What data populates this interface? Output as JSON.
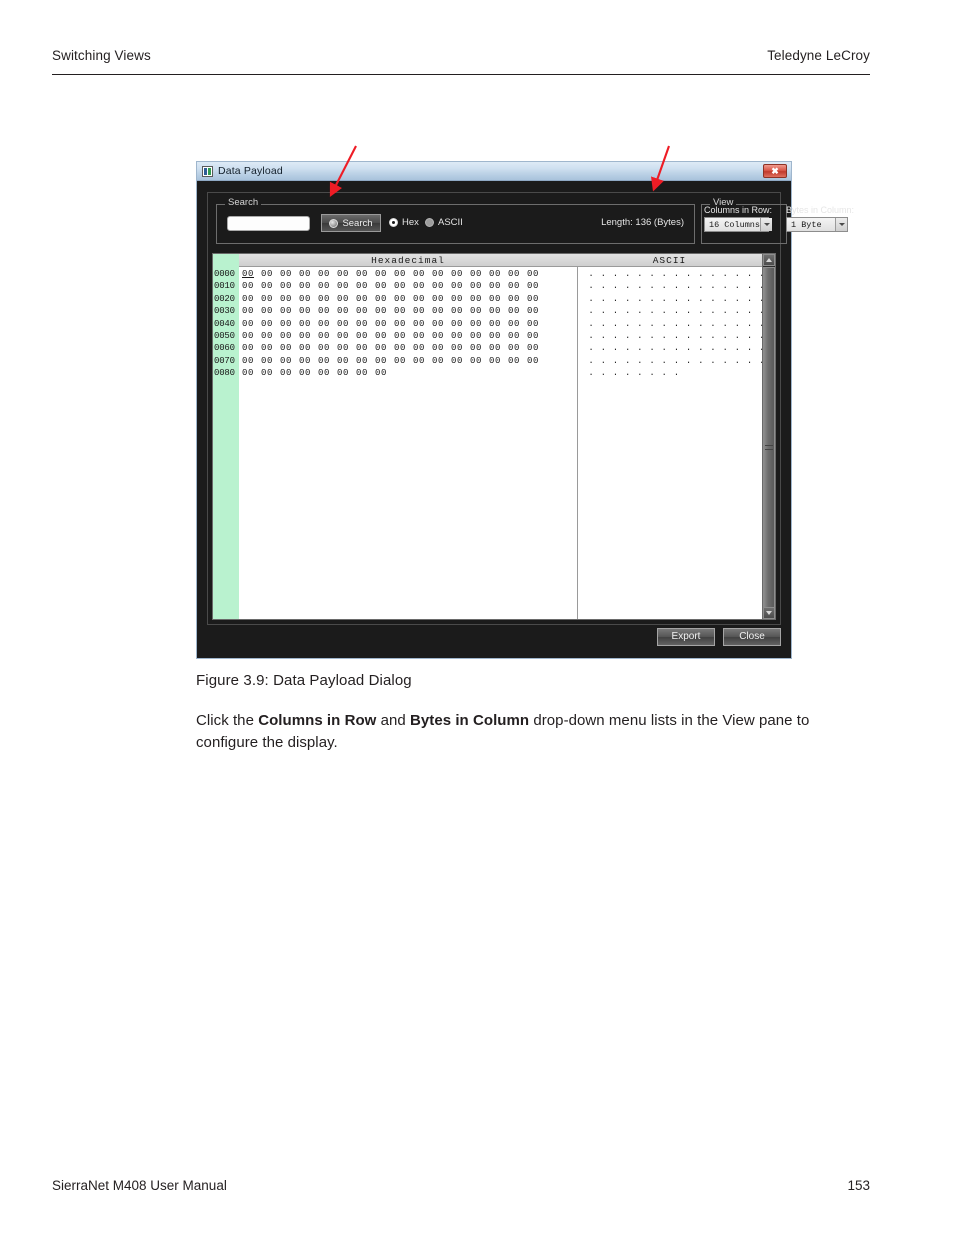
{
  "page": {
    "header_left": "Switching Views",
    "header_right": "Teledyne LeCroy",
    "footer_left": "SierraNet M408 User Manual",
    "footer_right": "153"
  },
  "figure": {
    "caption": "Figure 3.9:  Data Payload Dialog"
  },
  "body": {
    "line_part1": "Click the ",
    "bold1": "Columns in Row",
    "line_part2": " and ",
    "bold2": "Bytes in Column",
    "line_part3": " drop-down menu lists in the View pane to configure the display."
  },
  "dialog": {
    "title": "Data Payload",
    "close_label": "✖",
    "search": {
      "group_label": "Search",
      "input_value": "",
      "input_placeholder": "",
      "button_label": "Search",
      "radio_hex_label": "Hex",
      "radio_ascii_label": "ASCII",
      "radio_selected": "Hex",
      "length_label": "Length: 136 (Bytes)"
    },
    "view": {
      "group_label": "View",
      "columns_in_row_label": "Columns in Row:",
      "bytes_in_column_label": "Bytes in Column:",
      "columns_in_row_value": "16  Columns",
      "bytes_in_column_value": "1 Byte"
    },
    "hexview": {
      "header_hex": "Hexadecimal",
      "header_ascii": "ASCII",
      "rows": [
        {
          "offset": "0000",
          "bytes": [
            "00",
            "00",
            "00",
            "00",
            "00",
            "00",
            "00",
            "00",
            "00",
            "00",
            "00",
            "00",
            "00",
            "00",
            "00",
            "00"
          ],
          "ascii": [
            ".",
            ".",
            ".",
            ".",
            ".",
            ".",
            ".",
            ".",
            ".",
            ".",
            ".",
            ".",
            ".",
            ".",
            ".",
            "."
          ]
        },
        {
          "offset": "0010",
          "bytes": [
            "00",
            "00",
            "00",
            "00",
            "00",
            "00",
            "00",
            "00",
            "00",
            "00",
            "00",
            "00",
            "00",
            "00",
            "00",
            "00"
          ],
          "ascii": [
            ".",
            ".",
            ".",
            ".",
            ".",
            ".",
            ".",
            ".",
            ".",
            ".",
            ".",
            ".",
            ".",
            ".",
            ".",
            "."
          ]
        },
        {
          "offset": "0020",
          "bytes": [
            "00",
            "00",
            "00",
            "00",
            "00",
            "00",
            "00",
            "00",
            "00",
            "00",
            "00",
            "00",
            "00",
            "00",
            "00",
            "00"
          ],
          "ascii": [
            ".",
            ".",
            ".",
            ".",
            ".",
            ".",
            ".",
            ".",
            ".",
            ".",
            ".",
            ".",
            ".",
            ".",
            ".",
            "."
          ]
        },
        {
          "offset": "0030",
          "bytes": [
            "00",
            "00",
            "00",
            "00",
            "00",
            "00",
            "00",
            "00",
            "00",
            "00",
            "00",
            "00",
            "00",
            "00",
            "00",
            "00"
          ],
          "ascii": [
            ".",
            ".",
            ".",
            ".",
            ".",
            ".",
            ".",
            ".",
            ".",
            ".",
            ".",
            ".",
            ".",
            ".",
            ".",
            "."
          ]
        },
        {
          "offset": "0040",
          "bytes": [
            "00",
            "00",
            "00",
            "00",
            "00",
            "00",
            "00",
            "00",
            "00",
            "00",
            "00",
            "00",
            "00",
            "00",
            "00",
            "00"
          ],
          "ascii": [
            ".",
            ".",
            ".",
            ".",
            ".",
            ".",
            ".",
            ".",
            ".",
            ".",
            ".",
            ".",
            ".",
            ".",
            ".",
            "."
          ]
        },
        {
          "offset": "0050",
          "bytes": [
            "00",
            "00",
            "00",
            "00",
            "00",
            "00",
            "00",
            "00",
            "00",
            "00",
            "00",
            "00",
            "00",
            "00",
            "00",
            "00"
          ],
          "ascii": [
            ".",
            ".",
            ".",
            ".",
            ".",
            ".",
            ".",
            ".",
            ".",
            ".",
            ".",
            ".",
            ".",
            ".",
            ".",
            "."
          ]
        },
        {
          "offset": "0060",
          "bytes": [
            "00",
            "00",
            "00",
            "00",
            "00",
            "00",
            "00",
            "00",
            "00",
            "00",
            "00",
            "00",
            "00",
            "00",
            "00",
            "00"
          ],
          "ascii": [
            ".",
            ".",
            ".",
            ".",
            ".",
            ".",
            ".",
            ".",
            ".",
            ".",
            ".",
            ".",
            ".",
            ".",
            ".",
            "."
          ]
        },
        {
          "offset": "0070",
          "bytes": [
            "00",
            "00",
            "00",
            "00",
            "00",
            "00",
            "00",
            "00",
            "00",
            "00",
            "00",
            "00",
            "00",
            "00",
            "00",
            "00"
          ],
          "ascii": [
            ".",
            ".",
            ".",
            ".",
            ".",
            ".",
            ".",
            ".",
            ".",
            ".",
            ".",
            ".",
            ".",
            ".",
            ".",
            "."
          ]
        },
        {
          "offset": "0080",
          "bytes": [
            "00",
            "00",
            "00",
            "00",
            "00",
            "00",
            "00",
            "00"
          ],
          "ascii": [
            ".",
            ".",
            ".",
            ".",
            ".",
            ".",
            ".",
            "."
          ]
        }
      ]
    },
    "footer": {
      "export_label": "Export",
      "close_label": "Close"
    }
  },
  "annotations": {
    "arrow_color": "#ee1c25",
    "arrow_search_target": "search-group",
    "arrow_view_target": "view-group"
  },
  "colors": {
    "offset_column": "#b9f2cf",
    "dialog_background": "#1b1b1b",
    "titlebar": "#b6cde3",
    "close_button": "#c0392b",
    "arrow": "#ee1c25"
  }
}
